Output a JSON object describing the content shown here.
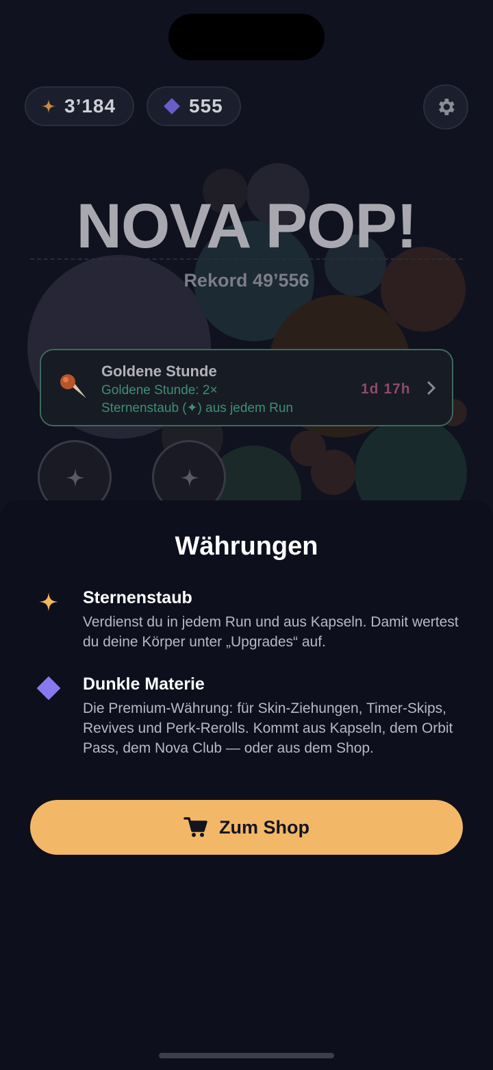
{
  "header": {
    "stardust": "3’184",
    "dark_matter": "555"
  },
  "game": {
    "title": "NOVA POP!",
    "record": "Rekord 49’556"
  },
  "event": {
    "title": "Goldene Stunde",
    "subtitle_line1": "Goldene Stunde: 2×",
    "subtitle_line2": "Sternenstaub (✦) aus jedem Run",
    "time_left": "1d 17h"
  },
  "sheet": {
    "title": "Währungen",
    "items": [
      {
        "icon": "star-icon",
        "title": "Sternenstaub",
        "text": "Verdienst du in jedem Run und aus Kapseln. Damit wertest du deine Körper unter „Upgrades“ auf."
      },
      {
        "icon": "diamond-icon",
        "title": "Dunkle Materie",
        "text": "Die Premium-Währung: für Skin-Ziehungen, Timer-Skips, Revives und Perk-Rerolls. Kommt aus Kapseln, dem Orbit Pass, dem Nova Club — oder aus dem Shop."
      }
    ],
    "shop_button": "Zum Shop"
  },
  "colors": {
    "accent": "#f2b868",
    "star": "#f5b75a",
    "diamond": "#8a78f0",
    "event_border": "#3d6a5c",
    "event_time": "#8f4a6a"
  }
}
